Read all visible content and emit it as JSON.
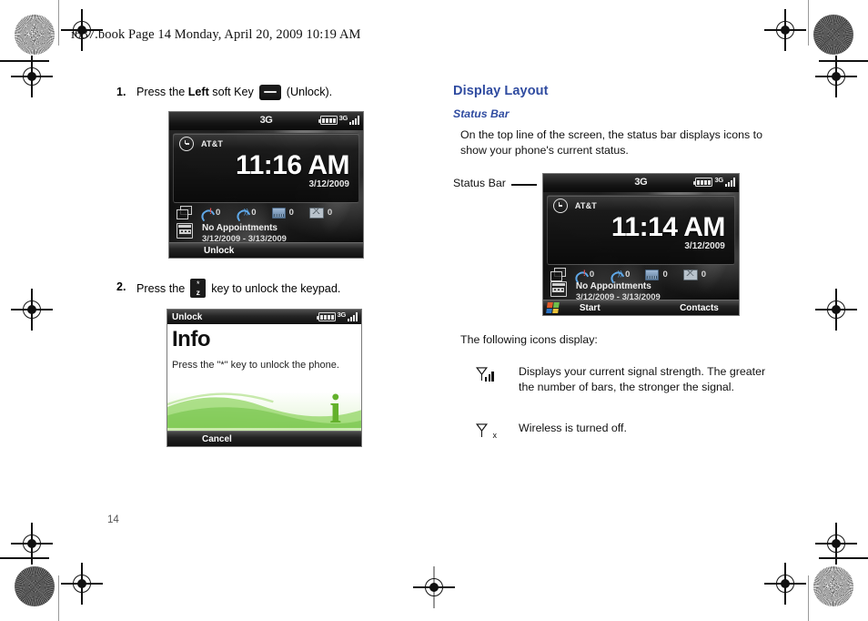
{
  "header": {
    "running_head": "i637.book  Page 14  Monday, April 20, 2009  10:19 AM"
  },
  "page_number": "14",
  "left_column": {
    "steps": [
      {
        "number": "1.",
        "text_before": "Press the",
        "bold_word": "Left",
        "text_middle": "soft Key",
        "icon": "soft-key-icon",
        "text_after": "(Unlock)."
      },
      {
        "number": "2.",
        "text_before": "Press the",
        "icon": "star-z-key-icon",
        "text_after": "key to unlock the keypad."
      }
    ],
    "today_screen": {
      "status_bar": {
        "network": "3G",
        "battery": "battery-icon",
        "data_3g": "3G",
        "signal": "signal-bars-icon"
      },
      "clock_panel": {
        "clock_icon": "clock-icon",
        "carrier": "AT&T",
        "time": "11:16 AM",
        "date": "3/12/2009"
      },
      "notifications": [
        {
          "icon": "missed-call-icon",
          "count": "0"
        },
        {
          "icon": "call-icon",
          "count": "0"
        },
        {
          "icon": "voicemail-icon",
          "count": "0"
        },
        {
          "icon": "message-icon",
          "count": "0"
        }
      ],
      "appointments": {
        "icon": "calendar-icon",
        "title": "No Appointments",
        "range": "3/12/2009 - 3/13/2009"
      },
      "soft_keys": {
        "left": "Unlock",
        "right": ""
      }
    },
    "info_screen": {
      "title_bar": {
        "title": "Unlock",
        "battery": "battery-icon",
        "data_3g": "3G",
        "signal": "signal-bars-icon"
      },
      "heading": "Info",
      "message": "Press the \"*\" key to unlock the phone.",
      "info_glyph": "i",
      "soft_keys": {
        "left": "Cancel"
      }
    }
  },
  "right_column": {
    "section_title": "Display Layout",
    "subsection_title": "Status Bar",
    "intro_paragraph": "On the top line of the screen, the status bar displays icons to show your phone's current status.",
    "callout_label": "Status Bar",
    "today_screen": {
      "status_bar": {
        "network": "3G",
        "battery": "battery-icon",
        "data_3g": "3G",
        "signal": "signal-bars-icon"
      },
      "clock_panel": {
        "clock_icon": "clock-icon",
        "carrier": "AT&T",
        "time": "11:14 AM",
        "date": "3/12/2009"
      },
      "notifications": [
        {
          "icon": "missed-call-icon",
          "count": "0"
        },
        {
          "icon": "call-icon",
          "count": "0"
        },
        {
          "icon": "voicemail-icon",
          "count": "0"
        },
        {
          "icon": "message-icon",
          "count": "0"
        }
      ],
      "appointments": {
        "icon": "calendar-icon",
        "title": "No Appointments",
        "range": "3/12/2009 - 3/13/2009"
      },
      "soft_keys": {
        "start_flag": "windows-start-icon",
        "left": "Start",
        "right": "Contacts"
      }
    },
    "icons_intro": "The following icons display:",
    "icon_list": [
      {
        "icon": "signal-strength-icon",
        "description": "Displays your current signal strength. The greater the number of bars, the stronger the signal."
      },
      {
        "icon": "wireless-off-icon",
        "description": "Wireless is turned off."
      }
    ]
  },
  "colors": {
    "heading_blue": "#2f4ba0",
    "body_black": "#111111",
    "green_accent": "#63b12c"
  }
}
